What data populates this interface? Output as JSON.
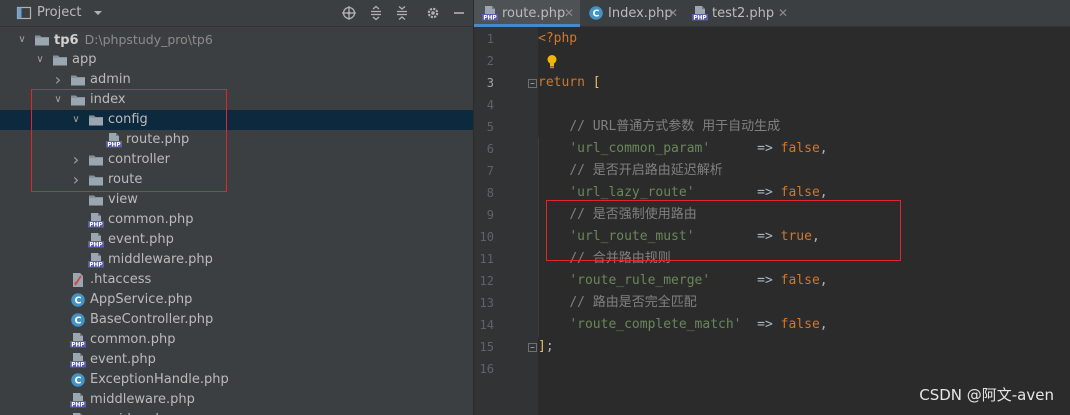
{
  "project_panel": {
    "title": "Project",
    "tree": [
      {
        "key": "tp6",
        "label": "tp6",
        "path": "D:\\phpstudy_pro\\tp6",
        "arrow": "down",
        "icon": "folder",
        "depth": 0,
        "bold": true
      },
      {
        "key": "app",
        "label": "app",
        "arrow": "down",
        "icon": "folder",
        "depth": 1
      },
      {
        "key": "admin",
        "label": "admin",
        "arrow": "right",
        "icon": "folder",
        "depth": 2
      },
      {
        "key": "index",
        "label": "index",
        "arrow": "down",
        "icon": "folder",
        "depth": 2
      },
      {
        "key": "config",
        "label": "config",
        "arrow": "down",
        "icon": "folder",
        "depth": 3,
        "selected": true
      },
      {
        "key": "route-php",
        "label": "route.php",
        "icon": "php",
        "depth": 4
      },
      {
        "key": "controller",
        "label": "controller",
        "arrow": "right",
        "icon": "folder",
        "depth": 3
      },
      {
        "key": "route",
        "label": "route",
        "arrow": "right",
        "icon": "folder",
        "depth": 3
      },
      {
        "key": "view",
        "label": "view",
        "icon": "folder",
        "depth": 3
      },
      {
        "key": "common-php-index",
        "label": "common.php",
        "icon": "php",
        "depth": 3
      },
      {
        "key": "event-php-index",
        "label": "event.php",
        "icon": "php",
        "depth": 3
      },
      {
        "key": "middleware-php-index",
        "label": "middleware.php",
        "icon": "php",
        "depth": 3
      },
      {
        "key": "htaccess",
        "label": ".htaccess",
        "icon": "htaccess",
        "depth": 2
      },
      {
        "key": "appservice",
        "label": "AppService.php",
        "icon": "class",
        "depth": 2
      },
      {
        "key": "basecontroller",
        "label": "BaseController.php",
        "icon": "class",
        "depth": 2
      },
      {
        "key": "common-php",
        "label": "common.php",
        "icon": "php",
        "depth": 2
      },
      {
        "key": "event-php",
        "label": "event.php",
        "icon": "php",
        "depth": 2
      },
      {
        "key": "exceptionhandle",
        "label": "ExceptionHandle.php",
        "icon": "class",
        "depth": 2
      },
      {
        "key": "middleware-php",
        "label": "middleware.php",
        "icon": "php",
        "depth": 2
      },
      {
        "key": "provider-php",
        "label": "provider.php",
        "icon": "php",
        "depth": 2
      }
    ]
  },
  "tabs": [
    {
      "key": "route",
      "label": "route.php",
      "icon": "php",
      "active": true
    },
    {
      "key": "index",
      "label": "Index.php",
      "icon": "class",
      "active": false
    },
    {
      "key": "test2",
      "label": "test2.php",
      "icon": "php",
      "active": false
    }
  ],
  "editor": {
    "current_line": 3,
    "lines": [
      {
        "n": "1",
        "tokens": [
          [
            "tag",
            "<?php"
          ]
        ]
      },
      {
        "n": "2",
        "tokens": [],
        "bulb": true
      },
      {
        "n": "3",
        "tokens": [
          [
            "kw",
            "return"
          ],
          [
            "op",
            " "
          ],
          [
            "brk",
            "["
          ]
        ],
        "fold": true
      },
      {
        "n": "4",
        "tokens": []
      },
      {
        "n": "5",
        "tokens": [
          [
            "op",
            "    "
          ],
          [
            "cmt",
            "// URL普通方式参数 用于自动生成"
          ]
        ]
      },
      {
        "n": "6",
        "tokens": [
          [
            "op",
            "    "
          ],
          [
            "str",
            "'url_common_param'"
          ],
          [
            "op",
            "      => "
          ],
          [
            "kw",
            "false"
          ],
          [
            "op",
            ","
          ]
        ]
      },
      {
        "n": "7",
        "tokens": [
          [
            "op",
            "    "
          ],
          [
            "cmt",
            "// 是否开启路由延迟解析"
          ]
        ]
      },
      {
        "n": "8",
        "tokens": [
          [
            "op",
            "    "
          ],
          [
            "str",
            "'url_lazy_route'"
          ],
          [
            "op",
            "        => "
          ],
          [
            "kw",
            "false"
          ],
          [
            "op",
            ","
          ]
        ]
      },
      {
        "n": "9",
        "tokens": [
          [
            "op",
            "    "
          ],
          [
            "cmt",
            "// 是否强制使用路由"
          ]
        ]
      },
      {
        "n": "10",
        "tokens": [
          [
            "op",
            "    "
          ],
          [
            "str",
            "'url_route_must'"
          ],
          [
            "op",
            "        => "
          ],
          [
            "kw",
            "true"
          ],
          [
            "op",
            ","
          ]
        ]
      },
      {
        "n": "11",
        "tokens": [
          [
            "op",
            "    "
          ],
          [
            "cmt",
            "// 合并路由规则"
          ]
        ]
      },
      {
        "n": "12",
        "tokens": [
          [
            "op",
            "    "
          ],
          [
            "str",
            "'route_rule_merge'"
          ],
          [
            "op",
            "      => "
          ],
          [
            "kw",
            "false"
          ],
          [
            "op",
            ","
          ]
        ]
      },
      {
        "n": "13",
        "tokens": [
          [
            "op",
            "    "
          ],
          [
            "cmt",
            "// 路由是否完全匹配"
          ]
        ]
      },
      {
        "n": "14",
        "tokens": [
          [
            "op",
            "    "
          ],
          [
            "str",
            "'route_complete_match'"
          ],
          [
            "op",
            "  => "
          ],
          [
            "kw",
            "false"
          ],
          [
            "op",
            ","
          ]
        ]
      },
      {
        "n": "15",
        "tokens": [
          [
            "brk",
            "]"
          ],
          [
            "op",
            ";"
          ]
        ],
        "fold": true
      },
      {
        "n": "16",
        "tokens": []
      }
    ]
  },
  "watermark": "CSDN @阿文-aven",
  "colors": {
    "annotation_red": "#e0252d",
    "selection": "#0d293e",
    "keyword": "#cc7832",
    "string": "#6a8759",
    "comment": "#808080"
  }
}
